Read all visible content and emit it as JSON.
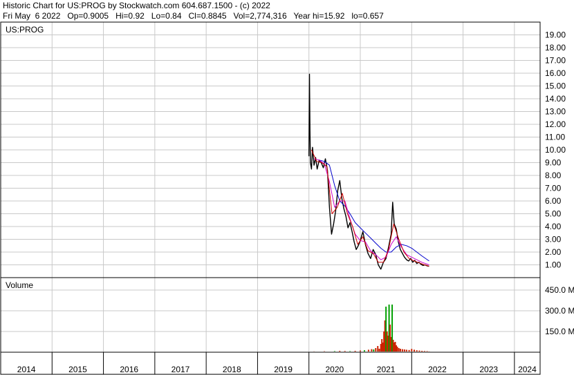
{
  "header": {
    "line1": "Historic Chart for US:PROG by Stockwatch.com 604.687.1500 - (c) 2022",
    "line2": "Fri May  6 2022   Op=0.9005   Hi=0.92   Lo=0.84   Cl=0.8845   Vol=2,774,316   Year hi=15.92   lo=0.657"
  },
  "chart_data": [
    {
      "type": "line",
      "title": "US:PROG",
      "xlim": [
        2014.0,
        2024.5
      ],
      "ylim": [
        0,
        20
      ],
      "y_ticks": [
        1,
        2,
        3,
        4,
        5,
        6,
        7,
        8,
        9,
        10,
        11,
        12,
        13,
        14,
        15,
        16,
        17,
        18,
        19
      ],
      "y_tick_labels": [
        "1.00",
        "2.00",
        "3.00",
        "4.00",
        "5.00",
        "6.00",
        "7.00",
        "8.00",
        "9.00",
        "10.00",
        "11.00",
        "12.00",
        "13.00",
        "14.00",
        "15.00",
        "16.00",
        "17.00",
        "18.00",
        "19.00"
      ],
      "x_tick_labels": [
        "2014",
        "2015",
        "2016",
        "2017",
        "2018",
        "2019",
        "2020",
        "2021",
        "2022",
        "2023",
        "2024"
      ],
      "grid": true,
      "colors": {
        "price": "#000000",
        "ma_short": "#cc0000",
        "ma_mid": "#cc00cc",
        "ma_long": "#0000cc"
      },
      "price": {
        "x": [
          2020.0,
          2020.01,
          2020.02,
          2020.03,
          2020.05,
          2020.07,
          2020.1,
          2020.13,
          2020.16,
          2020.2,
          2020.24,
          2020.28,
          2020.32,
          2020.36,
          2020.4,
          2020.44,
          2020.48,
          2020.52,
          2020.56,
          2020.6,
          2020.64,
          2020.68,
          2020.72,
          2020.76,
          2020.8,
          2020.84,
          2020.88,
          2020.92,
          2020.96,
          2021.0,
          2021.05,
          2021.1,
          2021.15,
          2021.2,
          2021.25,
          2021.3,
          2021.35,
          2021.4,
          2021.45,
          2021.5,
          2021.55,
          2021.6,
          2021.63,
          2021.66,
          2021.7,
          2021.74,
          2021.78,
          2021.82,
          2021.86,
          2021.9,
          2021.94,
          2021.98,
          2022.02,
          2022.06,
          2022.1,
          2022.14,
          2022.18,
          2022.22,
          2022.26,
          2022.3,
          2022.34
        ],
        "y": [
          9.5,
          15.92,
          11.5,
          9.0,
          8.5,
          10.2,
          8.8,
          9.4,
          8.5,
          9.2,
          9.0,
          8.6,
          9.3,
          8.4,
          5.5,
          3.4,
          4.2,
          5.2,
          6.8,
          7.6,
          6.2,
          5.4,
          4.8,
          3.9,
          4.3,
          3.6,
          2.8,
          2.2,
          2.5,
          2.9,
          3.6,
          2.6,
          1.9,
          1.5,
          2.2,
          1.8,
          1.0,
          0.657,
          1.2,
          1.5,
          2.4,
          3.4,
          5.9,
          4.2,
          3.8,
          2.8,
          2.2,
          1.9,
          1.6,
          1.4,
          1.3,
          1.5,
          1.2,
          1.35,
          1.1,
          1.2,
          1.05,
          0.95,
          1.0,
          0.92,
          0.8845
        ]
      },
      "ma_short": {
        "x": [
          2020.05,
          2020.15,
          2020.25,
          2020.35,
          2020.45,
          2020.55,
          2020.65,
          2020.75,
          2020.85,
          2020.95,
          2021.05,
          2021.15,
          2021.25,
          2021.35,
          2021.45,
          2021.55,
          2021.65,
          2021.75,
          2021.85,
          2021.95,
          2022.05,
          2022.15,
          2022.25,
          2022.34
        ],
        "y": [
          10.0,
          9.1,
          9.0,
          8.7,
          5.0,
          5.5,
          6.6,
          5.0,
          4.0,
          2.6,
          3.2,
          2.1,
          1.9,
          1.2,
          1.2,
          2.2,
          4.2,
          3.0,
          2.0,
          1.5,
          1.3,
          1.15,
          1.0,
          0.9
        ]
      },
      "ma_mid": {
        "x": [
          2020.1,
          2020.2,
          2020.3,
          2020.4,
          2020.5,
          2020.6,
          2020.7,
          2020.8,
          2020.9,
          2021.0,
          2021.1,
          2021.2,
          2021.3,
          2021.4,
          2021.5,
          2021.6,
          2021.7,
          2021.8,
          2021.9,
          2022.0,
          2022.1,
          2022.2,
          2022.34
        ],
        "y": [
          9.3,
          9.2,
          8.9,
          7.5,
          5.5,
          6.0,
          6.0,
          4.6,
          3.4,
          2.9,
          2.8,
          2.1,
          1.8,
          1.4,
          1.6,
          2.6,
          3.2,
          2.4,
          1.8,
          1.6,
          1.4,
          1.2,
          1.0
        ]
      },
      "ma_long": {
        "x": [
          2020.2,
          2020.3,
          2020.4,
          2020.5,
          2020.6,
          2020.7,
          2020.8,
          2020.9,
          2021.0,
          2021.1,
          2021.2,
          2021.3,
          2021.4,
          2021.5,
          2021.6,
          2021.7,
          2021.8,
          2021.9,
          2022.0,
          2022.1,
          2022.2,
          2022.34
        ],
        "y": [
          9.2,
          9.1,
          8.8,
          7.2,
          6.0,
          5.6,
          5.0,
          4.3,
          3.9,
          3.5,
          3.1,
          2.7,
          2.3,
          2.0,
          2.0,
          2.4,
          2.6,
          2.5,
          2.3,
          2.0,
          1.7,
          1.3
        ]
      }
    },
    {
      "type": "bar",
      "title": "Volume",
      "ylim": [
        0,
        540
      ],
      "y_ticks": [
        150,
        300,
        450
      ],
      "y_tick_labels": [
        "150.0 M",
        "300.0 M",
        "450.0 M"
      ],
      "colors": {
        "up": "#00a000",
        "down": "#cc2200"
      },
      "x": [
        2020.0,
        2020.1,
        2020.2,
        2020.3,
        2020.4,
        2020.5,
        2020.6,
        2020.7,
        2020.8,
        2020.9,
        2021.0,
        2021.08,
        2021.16,
        2021.22,
        2021.26,
        2021.3,
        2021.34,
        2021.37,
        2021.4,
        2021.42,
        2021.44,
        2021.46,
        2021.48,
        2021.5,
        2021.52,
        2021.54,
        2021.56,
        2021.58,
        2021.6,
        2021.62,
        2021.64,
        2021.66,
        2021.68,
        2021.7,
        2021.72,
        2021.75,
        2021.78,
        2021.82,
        2021.86,
        2021.9,
        2021.95,
        2022.0,
        2022.05,
        2022.1,
        2022.15,
        2022.2,
        2022.25,
        2022.3,
        2022.34
      ],
      "values": [
        4,
        6,
        5,
        7,
        5,
        8,
        10,
        9,
        8,
        10,
        12,
        14,
        18,
        22,
        20,
        30,
        45,
        25,
        60,
        95,
        70,
        150,
        230,
        330,
        150,
        120,
        345,
        200,
        110,
        345,
        90,
        70,
        75,
        50,
        40,
        30,
        25,
        22,
        20,
        18,
        16,
        24,
        18,
        14,
        12,
        10,
        9,
        8,
        6
      ],
      "up": [
        false,
        false,
        true,
        false,
        false,
        true,
        false,
        false,
        true,
        false,
        false,
        true,
        false,
        false,
        true,
        false,
        false,
        false,
        false,
        false,
        false,
        false,
        false,
        true,
        false,
        false,
        true,
        false,
        false,
        true,
        false,
        false,
        false,
        false,
        false,
        false,
        false,
        false,
        false,
        false,
        false,
        false,
        false,
        false,
        false,
        false,
        false,
        false,
        false
      ]
    }
  ]
}
